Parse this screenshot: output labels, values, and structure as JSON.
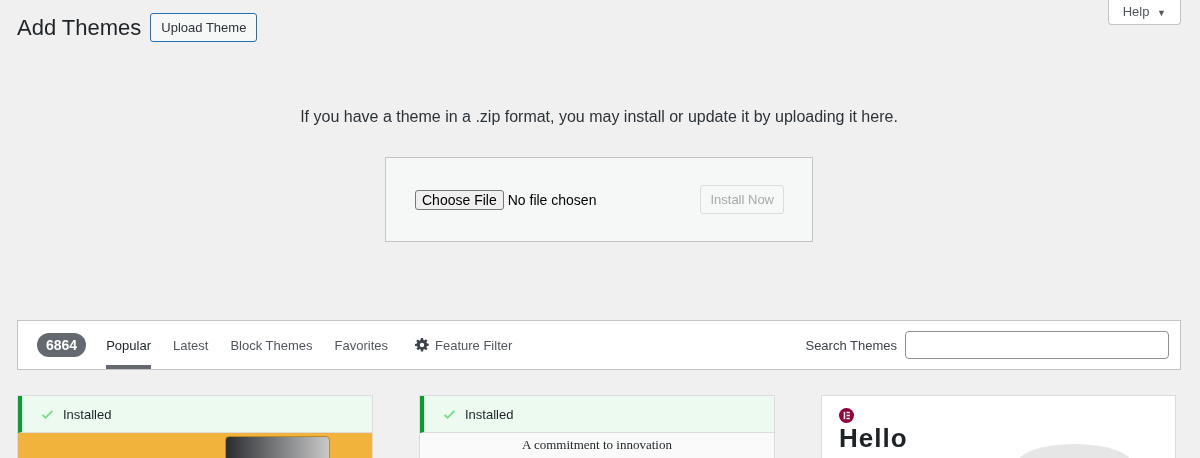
{
  "page_title": "Add Themes",
  "upload_button": "Upload Theme",
  "help_button": {
    "label": "Help",
    "caret": "▼"
  },
  "upload": {
    "message": "If you have a theme in a .zip format, you may install or update it by uploading it here.",
    "choose_button": "Choose File",
    "file_status": "No file chosen",
    "install_button": {
      "label": "Install Now",
      "disabled": true
    }
  },
  "filter_bar": {
    "count": "6864",
    "tabs": [
      {
        "label": "Popular",
        "selected": true
      },
      {
        "label": "Latest",
        "selected": false
      },
      {
        "label": "Block Themes",
        "selected": false
      },
      {
        "label": "Favorites",
        "selected": false
      }
    ],
    "feature_filter": "Feature Filter",
    "search_label": "Search Themes"
  },
  "themes": [
    {
      "installed": true,
      "installed_label": "Installed",
      "kind": "photo"
    },
    {
      "installed": true,
      "installed_label": "Installed",
      "kind": "text",
      "preview_text": "A commitment to innovation"
    },
    {
      "installed": false,
      "kind": "logo",
      "preview_text": "Hello"
    }
  ]
}
